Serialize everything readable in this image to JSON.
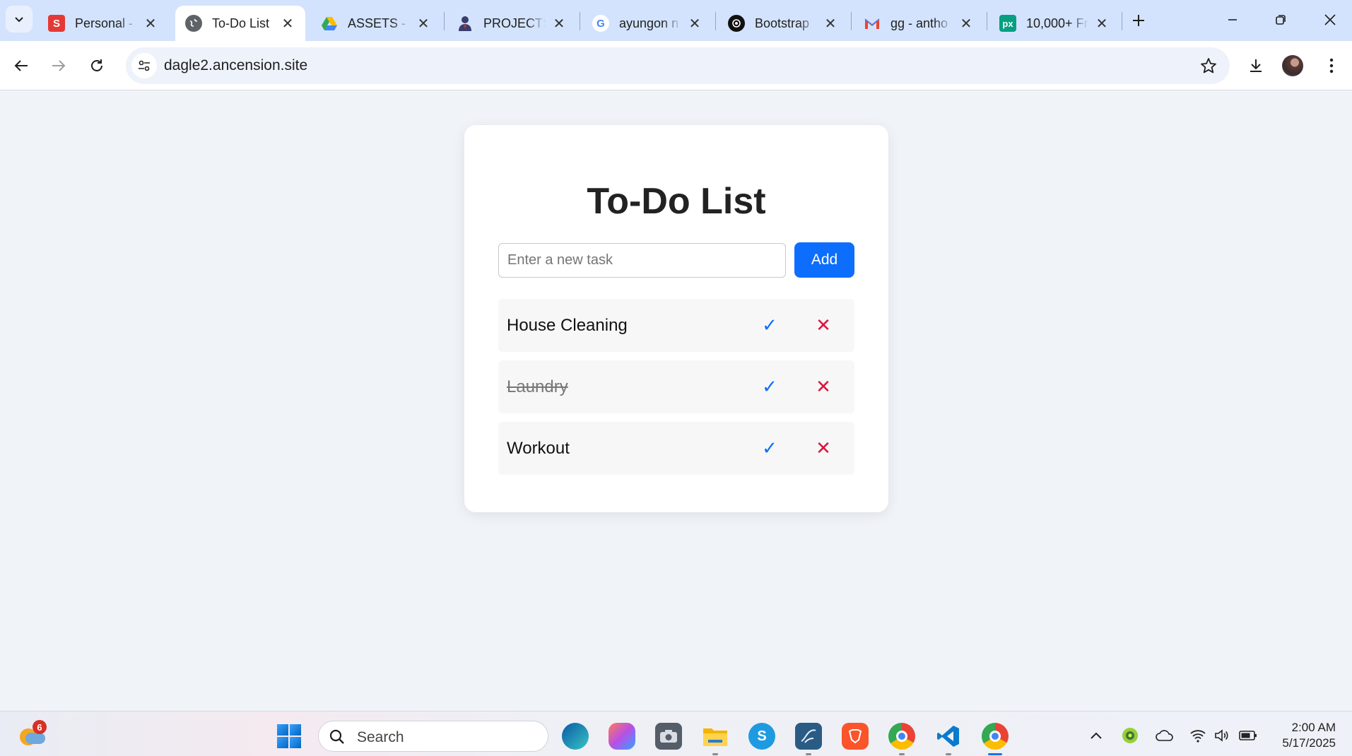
{
  "browser": {
    "tabs": [
      {
        "label": "Personal -",
        "favicon_text": "S",
        "favicon_color": "#e53935"
      },
      {
        "label": "To-Do List",
        "favicon_text": "",
        "favicon_color": "#5f6368",
        "active": true
      },
      {
        "label": "ASSETS - G",
        "favicon_text": "",
        "favicon_color": "#34a853"
      },
      {
        "label": "PROJECTS|",
        "favicon_text": "",
        "favicon_color": "#3c3c6e"
      },
      {
        "label": "ayungon n",
        "favicon_text": "G",
        "favicon_color": "#4285f4"
      },
      {
        "label": "Bootstrap",
        "favicon_text": "",
        "favicon_color": "#111111"
      },
      {
        "label": "gg - antho",
        "favicon_text": "M",
        "favicon_color": "#ea4335"
      },
      {
        "label": "10,000+ Fr",
        "favicon_text": "px",
        "favicon_color": "#05a081"
      }
    ],
    "url": "dagle2.ancension.site"
  },
  "app": {
    "title": "To-Do List",
    "input_placeholder": "Enter a new task",
    "add_label": "Add",
    "check_symbol": "✓",
    "delete_symbol": "✕",
    "tasks": [
      {
        "name": "House Cleaning",
        "completed": false
      },
      {
        "name": "Laundry",
        "completed": true
      },
      {
        "name": "Workout",
        "completed": false
      }
    ]
  },
  "taskbar": {
    "search_label": "Search",
    "weather_badge": "6",
    "time": "2:00 AM",
    "date": "5/17/2025"
  },
  "colors": {
    "primary": "#0d6efd",
    "delete": "#dc143c",
    "tabstrip": "#d3e3fd",
    "page_bg": "#f0f3f8"
  }
}
